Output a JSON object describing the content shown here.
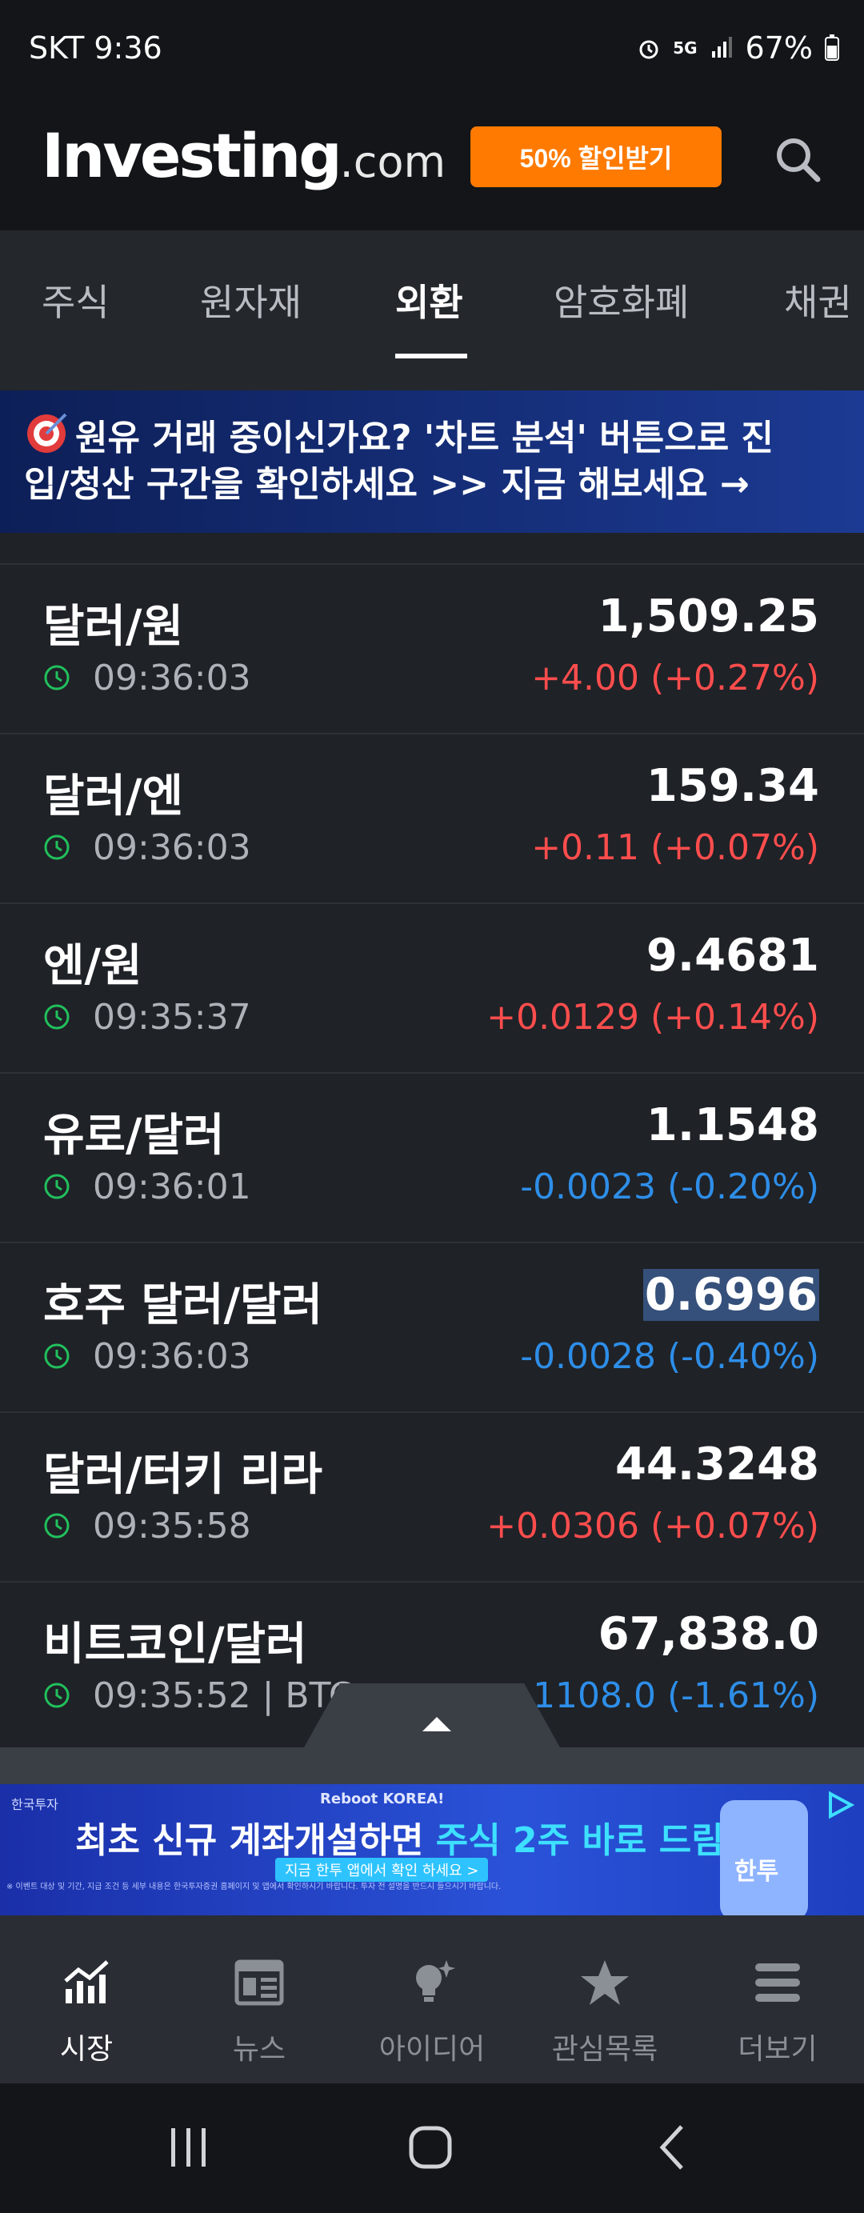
{
  "status_bar": {
    "carrier_time": "SKT 9:36",
    "battery": "67%",
    "network": "5G"
  },
  "header": {
    "logo_main": "Investing",
    "logo_suffix": ".com",
    "promo_label": "50% 할인받기"
  },
  "tabs": [
    {
      "label": "주식"
    },
    {
      "label": "원자재"
    },
    {
      "label": "외환"
    },
    {
      "label": "암호화폐"
    },
    {
      "label": "채권"
    }
  ],
  "banner": {
    "line1": "원유 거래 중이신가요? '차트 분석' 버튼으로 진",
    "line2": "입/청산 구간을 확인하세요 >> 지금 해보세요 →"
  },
  "quotes": [
    {
      "name": "달러/원",
      "time": "09:36:03",
      "price": "1,509.25",
      "change": "+4.00 (+0.27%)",
      "direction": "up"
    },
    {
      "name": "달러/엔",
      "time": "09:36:03",
      "price": "159.34",
      "change": "+0.11 (+0.07%)",
      "direction": "up"
    },
    {
      "name": "엔/원",
      "time": "09:35:37",
      "price": "9.4681",
      "change": "+0.0129 (+0.14%)",
      "direction": "up"
    },
    {
      "name": "유로/달러",
      "time": "09:36:01",
      "price": "1.1548",
      "change": "-0.0023 (-0.20%)",
      "direction": "down"
    },
    {
      "name": "호주 달러/달러",
      "time": "09:36:03",
      "price": "0.6996",
      "change": "-0.0028 (-0.40%)",
      "direction": "down"
    },
    {
      "name": "달러/터키 리라",
      "time": "09:35:58",
      "price": "44.3248",
      "change": "+0.0306 (+0.07%)",
      "direction": "up"
    },
    {
      "name": "비트코인/달러",
      "time": "09:35:52 | BTC",
      "price": "67,838.0",
      "change": "-1108.0 (-1.61%)",
      "direction": "down"
    }
  ],
  "ad": {
    "small_left": "한국투자",
    "small_top": "Reboot KOREA!",
    "headline_main": "최초 신규 계좌개설하면 ",
    "headline_accent": "주식 2주 바로 드림!",
    "sub_button": "지금 한투 앱에서 확인 하세요 >",
    "disclaimer": "※ 이벤트 대상 및 기간, 지급 조건 등 세부 내용은 한국투자증권 홈페이지 및 앱에서 확인하시기 바랍니다. 투자 전 설명을 반드시 들으시기 바랍니다.",
    "app_label": "한투"
  },
  "bottom_nav": [
    {
      "label": "시장",
      "icon": "chart-icon",
      "active": true
    },
    {
      "label": "뉴스",
      "icon": "news-icon",
      "active": false
    },
    {
      "label": "아이디어",
      "icon": "lightbulb-icon",
      "active": false
    },
    {
      "label": "관심목록",
      "icon": "star-icon",
      "active": false
    },
    {
      "label": "더보기",
      "icon": "menu-icon",
      "active": false
    }
  ],
  "colors": {
    "up": "#ff4d4d",
    "down": "#2e8ee8",
    "accent": "#ff7a00"
  }
}
